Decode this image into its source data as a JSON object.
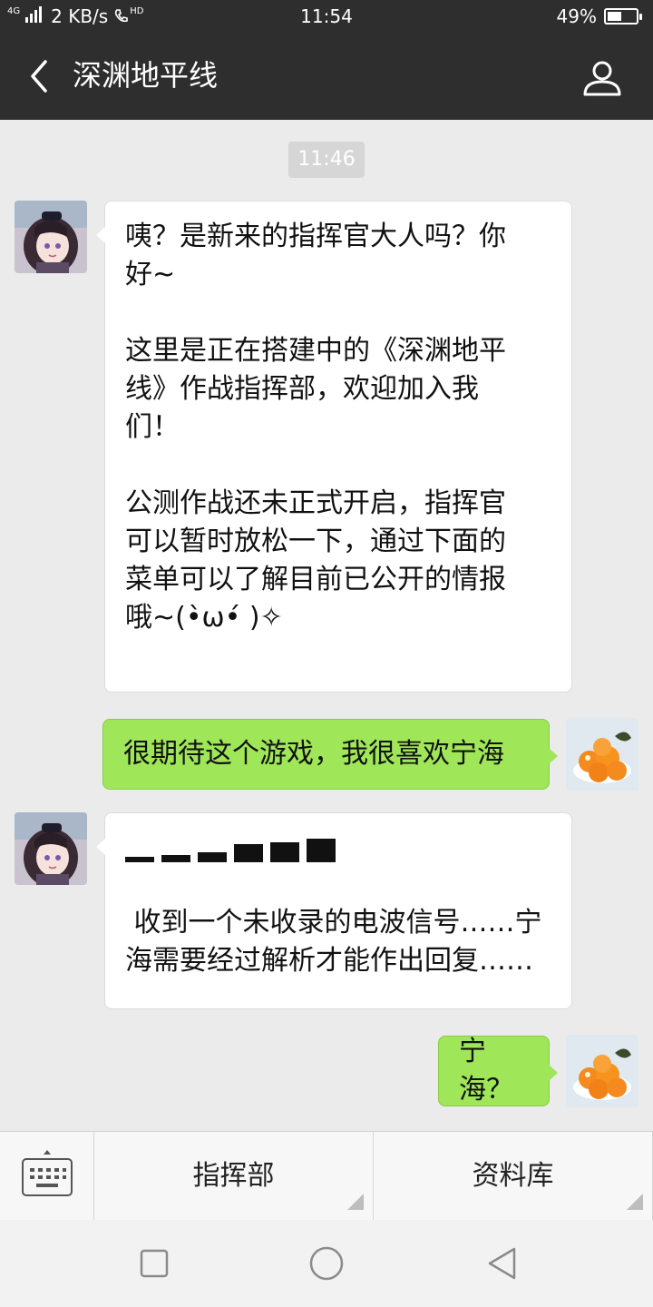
{
  "status_bar": {
    "network": "4G",
    "speed": "2 KB/s",
    "hd_label": "HD",
    "time": "11:54",
    "battery_percent": "49%",
    "battery_level": 0.49
  },
  "nav": {
    "title": "深渊地平线",
    "back_icon": "chevron-left-icon",
    "profile_icon": "person-icon"
  },
  "chat": {
    "timestamp": "11:46",
    "messages": [
      {
        "direction": "in",
        "paragraphs": [
          "咦？是新来的指挥官大人吗？你\n好~",
          "这里是正在搭建中的《深渊地平\n线》作战指挥部，欢迎加入我\n们！",
          "公测作战还未正式开启，指挥官\n可以暂时放松一下，通过下面的\n菜单可以了解目前已公开的情报\n哦~(•̀ω•́ )✧"
        ]
      },
      {
        "direction": "out",
        "text": "很期待这个游戏，我很喜欢宁海"
      },
      {
        "direction": "in",
        "signal_icon": "signal-bars-icon",
        "text": " 收到一个未收录的电波信号……宁\n海需要经过解析才能作出回复……"
      },
      {
        "direction": "out",
        "text": "宁海？"
      }
    ]
  },
  "menu": {
    "keyboard_icon": "keyboard-icon",
    "items": [
      {
        "label": "指挥部"
      },
      {
        "label": "资料库"
      }
    ]
  },
  "system_nav": {
    "recents_icon": "square-icon",
    "home_icon": "circle-icon",
    "back_icon": "triangle-back-icon"
  }
}
